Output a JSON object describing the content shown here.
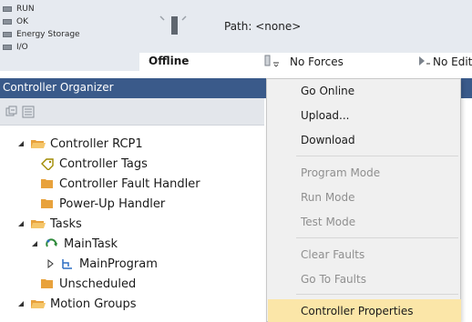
{
  "status_indicators": [
    {
      "label": "RUN"
    },
    {
      "label": "OK"
    },
    {
      "label": "Energy Storage"
    },
    {
      "label": "I/O"
    }
  ],
  "path_label": "Path: <none>",
  "mode": {
    "controller_state": "Offline",
    "forces": "No Forces",
    "edits": "No Edits"
  },
  "organizer": {
    "title": "Controller Organizer"
  },
  "tree": [
    {
      "label": "Controller RCP1",
      "icon": "folder-open-icon",
      "expander": "expanded"
    },
    {
      "label": "Controller Tags",
      "icon": "tag-icon",
      "expander": "none"
    },
    {
      "label": "Controller Fault Handler",
      "icon": "folder-icon",
      "expander": "none"
    },
    {
      "label": "Power-Up Handler",
      "icon": "folder-icon",
      "expander": "none"
    },
    {
      "label": "Tasks",
      "icon": "folder-open-icon",
      "expander": "expanded"
    },
    {
      "label": "MainTask",
      "icon": "task-icon",
      "expander": "expanded"
    },
    {
      "label": "MainProgram",
      "icon": "program-icon",
      "expander": "collapsed"
    },
    {
      "label": "Unscheduled",
      "icon": "folder-icon",
      "expander": "none"
    },
    {
      "label": "Motion Groups",
      "icon": "folder-open-icon",
      "expander": "expanded"
    }
  ],
  "context_menu": [
    {
      "label": "Go Online",
      "enabled": true
    },
    {
      "label": "Upload...",
      "enabled": true
    },
    {
      "label": "Download",
      "enabled": true
    },
    {
      "label": "Program Mode",
      "enabled": false
    },
    {
      "label": "Run Mode",
      "enabled": false
    },
    {
      "label": "Test Mode",
      "enabled": false
    },
    {
      "label": "Clear Faults",
      "enabled": false
    },
    {
      "label": "Go To Faults",
      "enabled": false
    },
    {
      "label": "Controller Properties",
      "enabled": true,
      "highlighted": true
    }
  ],
  "colors": {
    "organizer_header": "#3a5a8a",
    "menu_highlight": "#fbe6a8",
    "folder": "#e8a23c",
    "disabled_text": "#8f8f8f"
  }
}
